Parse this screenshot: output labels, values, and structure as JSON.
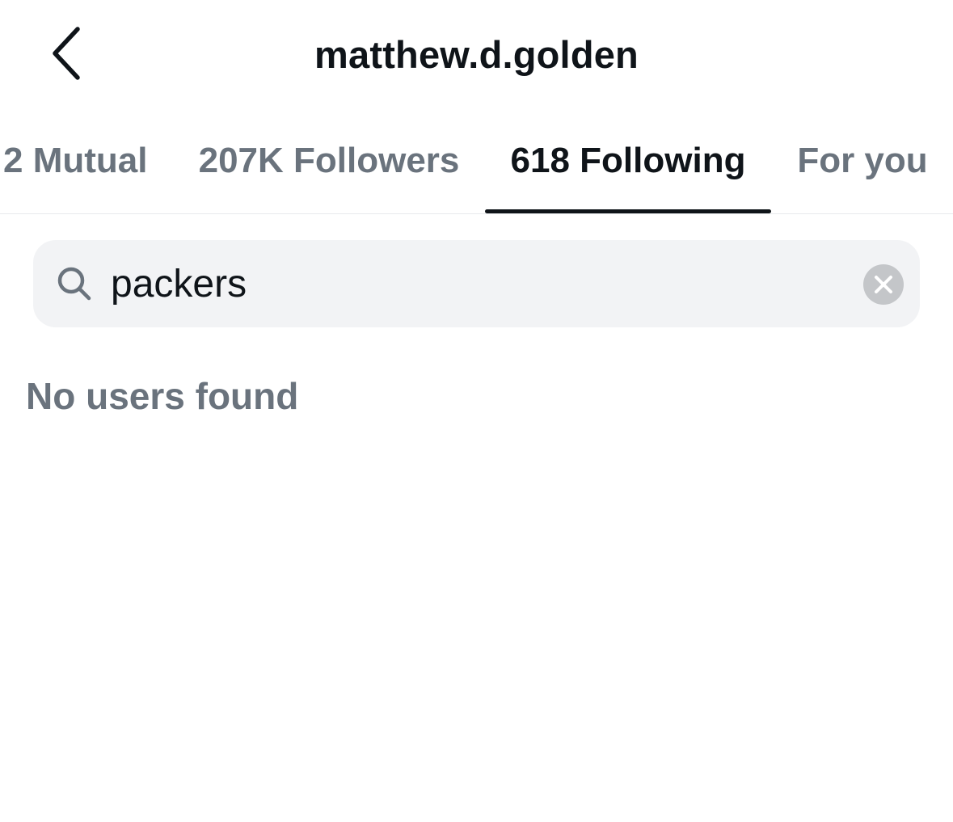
{
  "header": {
    "title": "matthew.d.golden",
    "back_icon": "chevron-left-icon"
  },
  "tabs": [
    {
      "label": "2 Mutual",
      "active": false
    },
    {
      "label": "207K Followers",
      "active": false
    },
    {
      "label": "618 Following",
      "active": true
    },
    {
      "label": "For you",
      "active": false
    }
  ],
  "search": {
    "value": "packers",
    "search_icon": "search-icon",
    "clear_icon": "clear-icon"
  },
  "results": {
    "empty_message": "No users found"
  },
  "colors": {
    "text_primary": "#0f1419",
    "text_secondary": "#6a737d",
    "search_background": "#f2f3f5",
    "clear_button": "#c4c6c9"
  }
}
